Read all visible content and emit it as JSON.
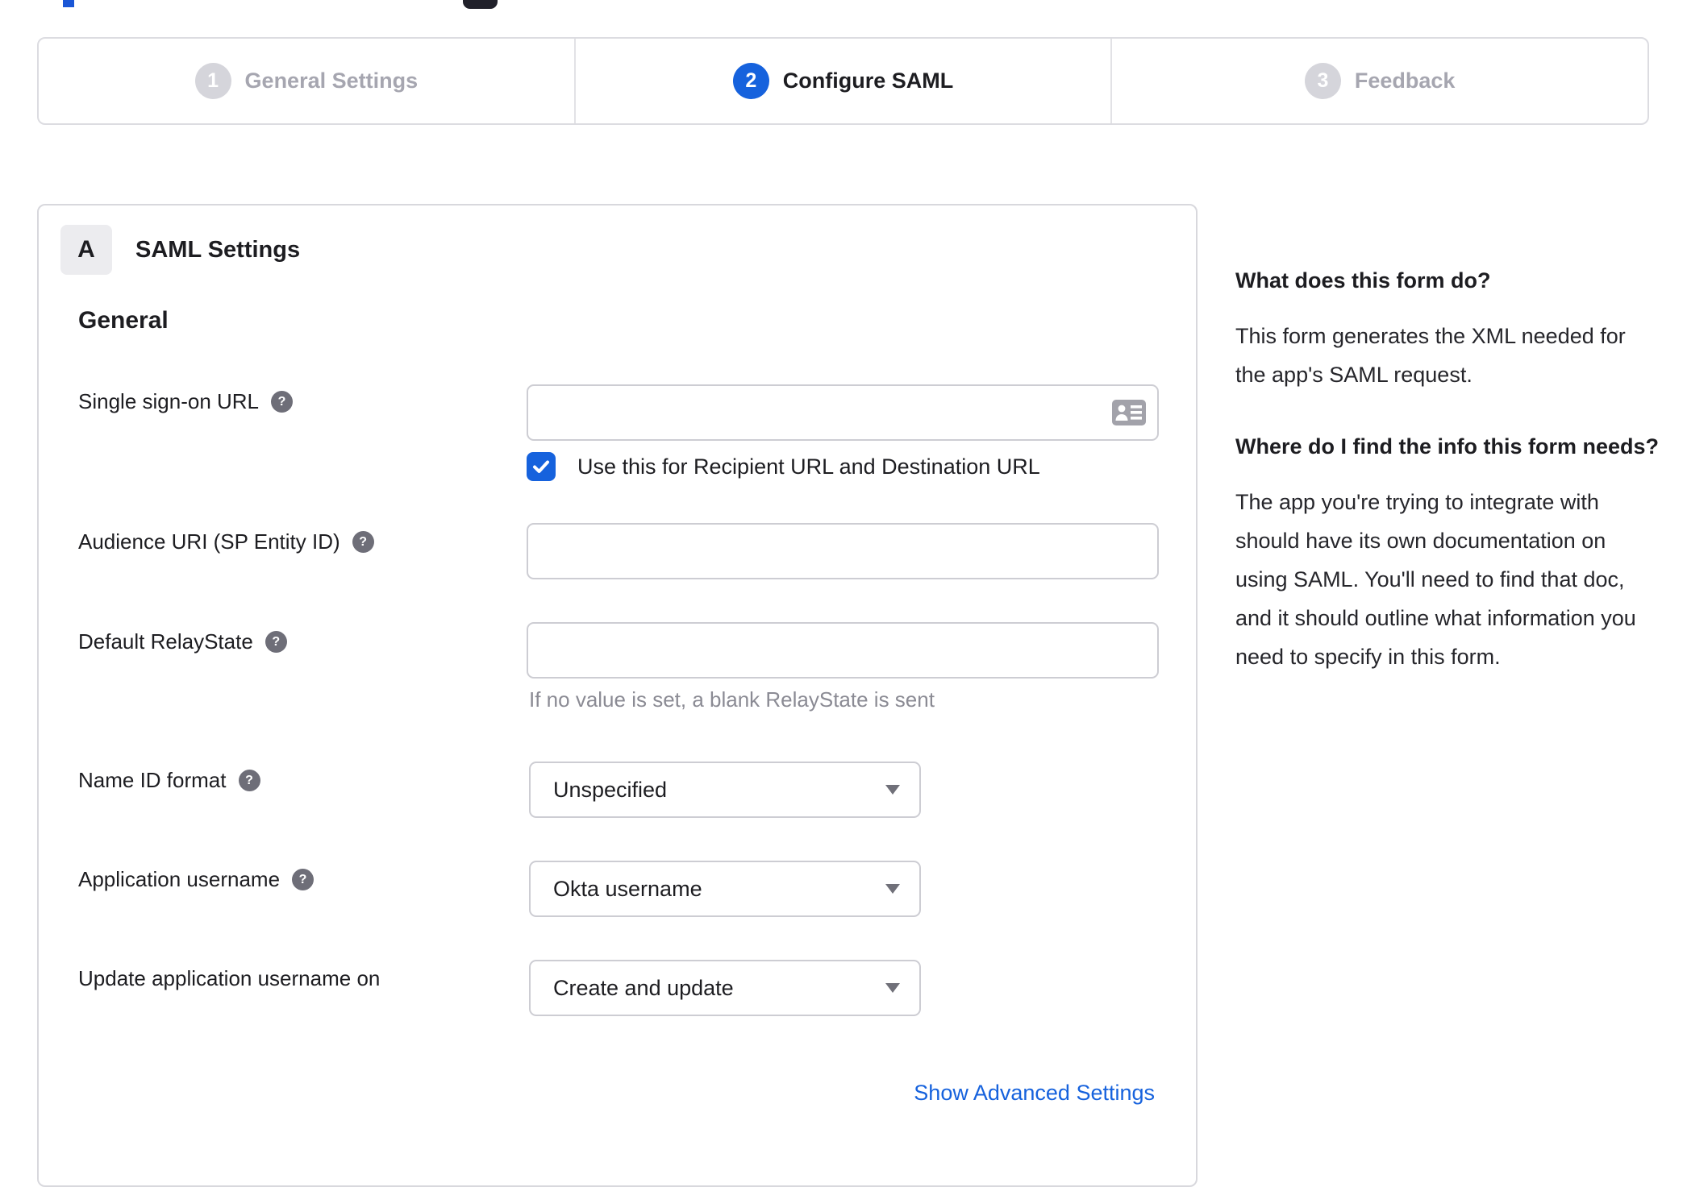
{
  "stepper": {
    "steps": [
      {
        "number": "1",
        "label": "General Settings",
        "state": "inactive"
      },
      {
        "number": "2",
        "label": "Configure SAML",
        "state": "active"
      },
      {
        "number": "3",
        "label": "Feedback",
        "state": "inactive"
      }
    ]
  },
  "panel": {
    "badge": "A",
    "title": "SAML Settings",
    "section_heading": "General",
    "fields": [
      {
        "label": "Single sign-on URL",
        "has_help": true,
        "type": "text",
        "value": "",
        "trailing_icon": "contact-card-icon",
        "checkbox": {
          "checked": true,
          "label": "Use this for Recipient URL and Destination URL"
        }
      },
      {
        "label": "Audience URI (SP Entity ID)",
        "has_help": true,
        "type": "text",
        "value": ""
      },
      {
        "label": "Default RelayState",
        "has_help": true,
        "type": "text",
        "value": "",
        "helper": "If no value is set, a blank RelayState is sent"
      },
      {
        "label": "Name ID format",
        "has_help": true,
        "type": "select",
        "value": "Unspecified"
      },
      {
        "label": "Application username",
        "has_help": true,
        "type": "select",
        "value": "Okta username"
      },
      {
        "label": "Update application username on",
        "has_help": false,
        "type": "select",
        "value": "Create and update"
      }
    ],
    "advanced_link": "Show Advanced Settings"
  },
  "sidebar": {
    "heading1": "What does this form do?",
    "para1": "This form generates the XML needed for the app's SAML request.",
    "heading2": "Where do I find the info this form needs?",
    "para2": "The app you're trying to integrate with should have its own documentation on using SAML. You'll need to find that doc, and it should outline what information you need to specify in this form."
  },
  "icons": {
    "help_glyph": "?",
    "checkbox_check": "checkmark",
    "dropdown_caret": "triangle-down",
    "sso_trailing": "contact-card"
  },
  "colors": {
    "accent_blue": "#1662dd",
    "dark_text": "#1d1d21",
    "inactive_gray": "#a6a6b0",
    "border_gray": "#d8d8dd",
    "helper_gray": "#8b8b94"
  }
}
